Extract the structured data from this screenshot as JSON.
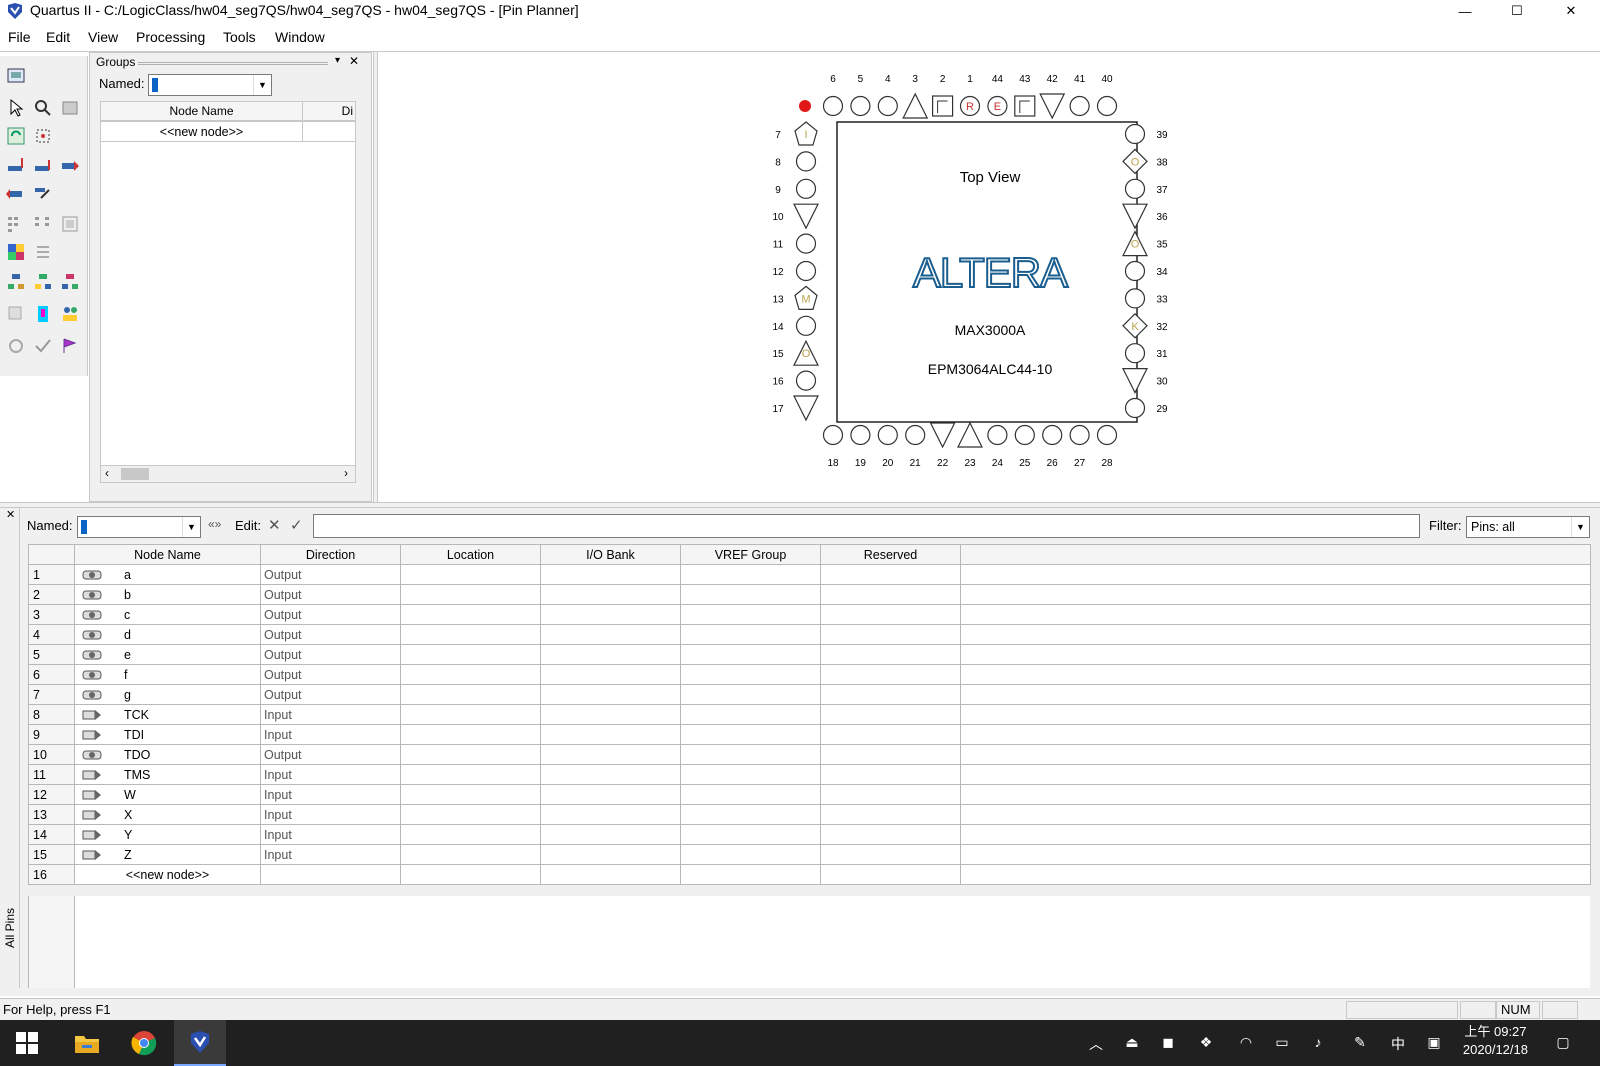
{
  "window": {
    "title": "Quartus II - C:/LogicClass/hw04_seg7QS/hw04_seg7QS - hw04_seg7QS - [Pin Planner]",
    "controls": {
      "minimize": "—",
      "maximize": "☐",
      "close": "✕"
    }
  },
  "menu": [
    "File",
    "Edit",
    "View",
    "Processing",
    "Tools",
    "Window"
  ],
  "groups_panel": {
    "title": "Groups",
    "named_label": "Named:",
    "named_value": "*",
    "columns": [
      "Node Name",
      "Di"
    ],
    "rows": [
      "<<new node>>"
    ]
  },
  "chip": {
    "title": "Top View",
    "logo": "ALTERA",
    "family": "MAX3000A",
    "device": "EPM3064ALC44-10",
    "top_pins": [
      "6",
      "5",
      "4",
      "3",
      "2",
      "1",
      "44",
      "43",
      "42",
      "41",
      "40"
    ],
    "bottom_pins": [
      "18",
      "19",
      "20",
      "21",
      "22",
      "23",
      "24",
      "25",
      "26",
      "27",
      "28"
    ],
    "left_pins": [
      "7",
      "8",
      "9",
      "10",
      "11",
      "12",
      "13",
      "14",
      "15",
      "16",
      "17"
    ],
    "right_pins": [
      "39",
      "38",
      "37",
      "36",
      "35",
      "34",
      "33",
      "32",
      "31",
      "30",
      "29"
    ],
    "pin_letters": {
      "R": "R",
      "E": "E",
      "I": "I",
      "M": "M",
      "O": "O",
      "K": "K"
    }
  },
  "pin_table": {
    "named_label": "Named:",
    "named_value": "*",
    "edit_label": "Edit:",
    "filter_label": "Filter:",
    "filter_value": "Pins: all",
    "side_label": "All Pins",
    "columns": [
      "Node Name",
      "Direction",
      "Location",
      "I/O Bank",
      "VREF Group",
      "Reserved"
    ],
    "rows": [
      {
        "n": "1",
        "name": "a",
        "dir": "Output"
      },
      {
        "n": "2",
        "name": "b",
        "dir": "Output"
      },
      {
        "n": "3",
        "name": "c",
        "dir": "Output"
      },
      {
        "n": "4",
        "name": "d",
        "dir": "Output"
      },
      {
        "n": "5",
        "name": "e",
        "dir": "Output"
      },
      {
        "n": "6",
        "name": "f",
        "dir": "Output"
      },
      {
        "n": "7",
        "name": "g",
        "dir": "Output"
      },
      {
        "n": "8",
        "name": "TCK",
        "dir": "Input"
      },
      {
        "n": "9",
        "name": "TDI",
        "dir": "Input"
      },
      {
        "n": "10",
        "name": "TDO",
        "dir": "Output"
      },
      {
        "n": "11",
        "name": "TMS",
        "dir": "Input"
      },
      {
        "n": "12",
        "name": "W",
        "dir": "Input"
      },
      {
        "n": "13",
        "name": "X",
        "dir": "Input"
      },
      {
        "n": "14",
        "name": "Y",
        "dir": "Input"
      },
      {
        "n": "15",
        "name": "Z",
        "dir": "Input"
      }
    ],
    "new_row": {
      "n": "16",
      "name": "<<new node>>"
    }
  },
  "status": {
    "help": "For Help, press F1",
    "num": "NUM"
  },
  "taskbar": {
    "time": "上午 09:27",
    "date": "2020/12/18",
    "ime": "中"
  },
  "colors": {
    "accent": "#0a64c8",
    "logo": "#1a5d8f",
    "red_pin": "#e01818",
    "taskbar": "#202020"
  }
}
